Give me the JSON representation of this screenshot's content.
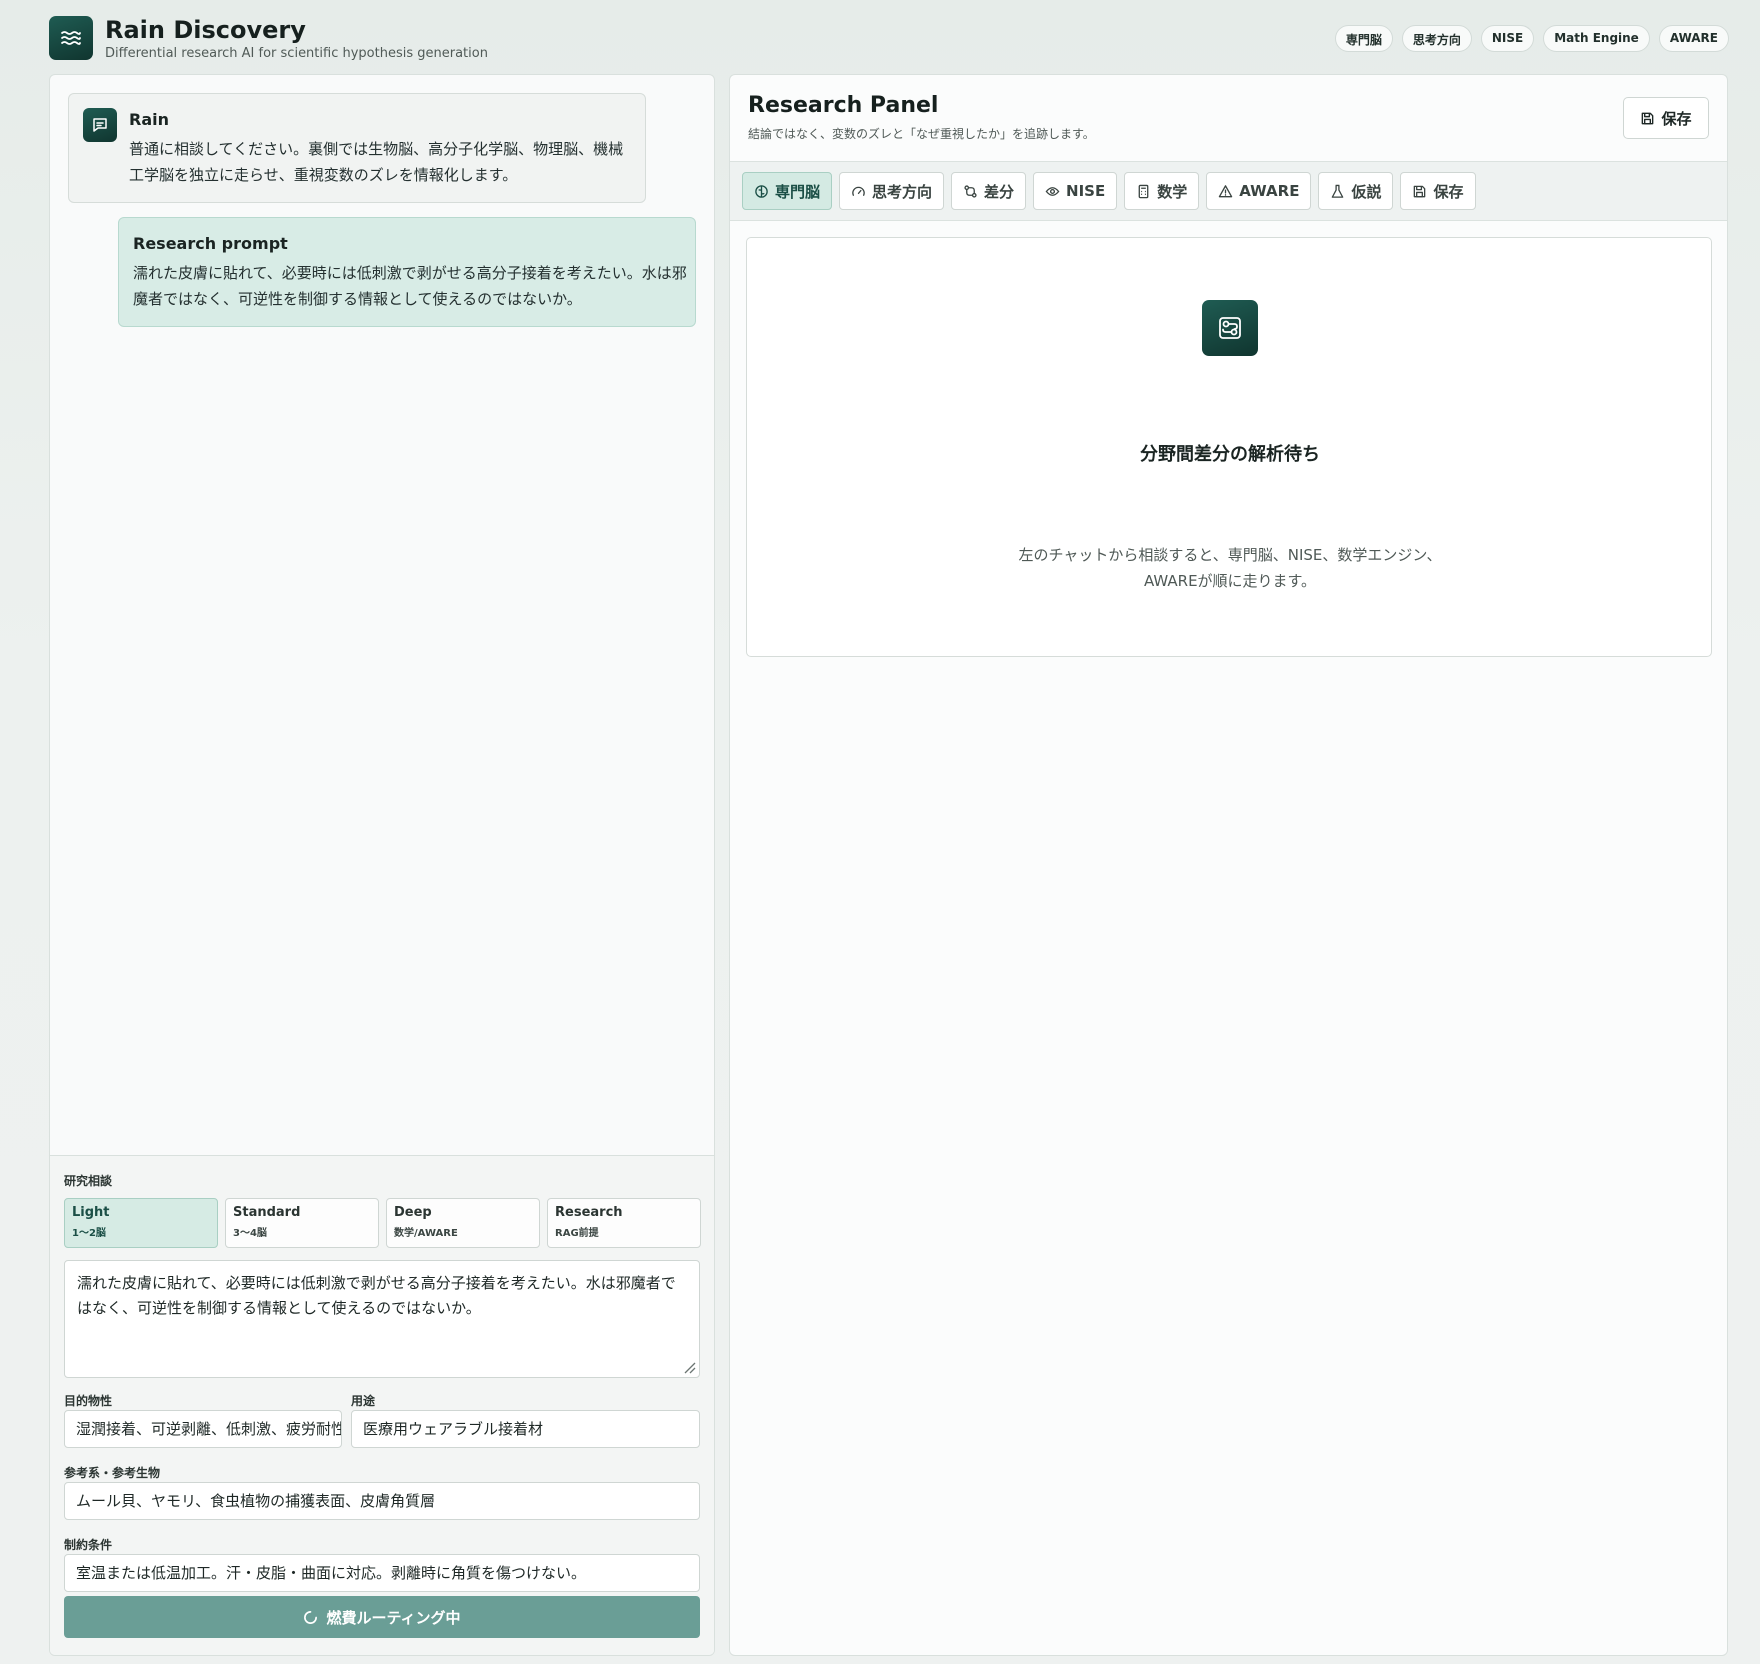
{
  "app": {
    "title": "Rain Discovery",
    "subtitle": "Differential research AI for scientific hypothesis generation"
  },
  "header_chips": [
    "専門脳",
    "思考方向",
    "NISE",
    "Math Engine",
    "AWARE"
  ],
  "chat": {
    "rain_message": {
      "name": "Rain",
      "text": "普通に相談してください。裏側では生物脳、高分子化学脳、物理脳、機械工学脳を独立に走らせ、重視変数のズレを情報化します。"
    },
    "prompt_message": {
      "name": "Research prompt",
      "text": "濡れた皮膚に貼れて、必要時には低刺激で剥がせる高分子接着を考えたい。水は邪魔者ではなく、可逆性を制御する情報として使えるのではないか。"
    }
  },
  "composer": {
    "section_label": "研究相談",
    "modes": [
      {
        "name": "Light",
        "sub": "1〜2脳",
        "active": true
      },
      {
        "name": "Standard",
        "sub": "3〜4脳",
        "active": false
      },
      {
        "name": "Deep",
        "sub": "数学/AWARE",
        "active": false
      },
      {
        "name": "Research",
        "sub": "RAG前提",
        "active": false
      }
    ],
    "prompt_value": "濡れた皮膚に貼れて、必要時には低刺激で剥がせる高分子接着を考えたい。水は邪魔者ではなく、可逆性を制御する情報として使えるのではないか。",
    "target_label": "目的物性",
    "target_value": "湿潤接着、可逆剥離、低刺激、疲労耐性",
    "use_label": "用途",
    "use_value": "医療用ウェアラブル接着材",
    "reference_label": "参考系・参考生物",
    "reference_value": "ムール貝、ヤモリ、食虫植物の捕獲表面、皮膚角質層",
    "constraint_label": "制約条件",
    "constraint_value": "室温または低温加工。汗・皮脂・曲面に対応。剥離時に角質を傷つけない。",
    "submit_label": "燃費ルーティング中"
  },
  "research_panel": {
    "title": "Research Panel",
    "subtitle": "結論ではなく、変数のズレと「なぜ重視したか」を追跡します。",
    "save_label": "保存",
    "tabs": [
      {
        "label": "専門脳",
        "icon": "brain-icon",
        "active": true
      },
      {
        "label": "思考方向",
        "icon": "gauge-icon",
        "active": false
      },
      {
        "label": "差分",
        "icon": "git-compare-icon",
        "active": false
      },
      {
        "label": "NISE",
        "icon": "eye-icon",
        "active": false
      },
      {
        "label": "数学",
        "icon": "calculator-icon",
        "active": false
      },
      {
        "label": "AWARE",
        "icon": "warning-icon",
        "active": false
      },
      {
        "label": "仮説",
        "icon": "flask-icon",
        "active": false
      },
      {
        "label": "保存",
        "icon": "save-icon",
        "active": false
      }
    ],
    "empty_title": "分野間差分の解析待ち",
    "empty_text_line1": "左のチャットから相談すると、専門脳、NISE、数学エンジン、",
    "empty_text_line2": "AWAREが順に走ります。"
  },
  "colors": {
    "brand_dark": "#10352f",
    "accent_light": "#d6ebe4",
    "submit": "#6a9e96"
  }
}
